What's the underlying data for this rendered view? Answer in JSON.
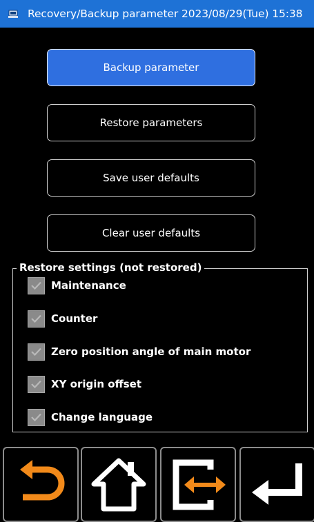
{
  "titlebar": {
    "title": "Recovery/Backup parameter 2023/08/29(Tue) 15:38",
    "icon": "machine-icon",
    "color": "#1e72d6"
  },
  "buttons": {
    "backup": "Backup parameter",
    "restore": "Restore parameters",
    "save_defaults": "Save user defaults",
    "clear_defaults": "Clear user defaults"
  },
  "restore_settings": {
    "legend": "Restore settings (not restored)",
    "items": [
      {
        "label": "Maintenance",
        "checked": true
      },
      {
        "label": "Counter",
        "checked": true
      },
      {
        "label": "Zero position angle of main motor",
        "checked": true
      },
      {
        "label": "XY origin offset",
        "checked": true
      },
      {
        "label": "Change language",
        "checked": true
      }
    ]
  },
  "navbar": {
    "items": [
      {
        "icon": "back-arrow-icon",
        "color": "#f28a1a"
      },
      {
        "icon": "home-icon",
        "color": "#ffffff"
      },
      {
        "icon": "exchange-icon",
        "color": "#f28a1a"
      },
      {
        "icon": "enter-icon",
        "color": "#ffffff"
      }
    ]
  },
  "colors": {
    "active_button": "#2f6fe0",
    "accent": "#f28a1a"
  }
}
